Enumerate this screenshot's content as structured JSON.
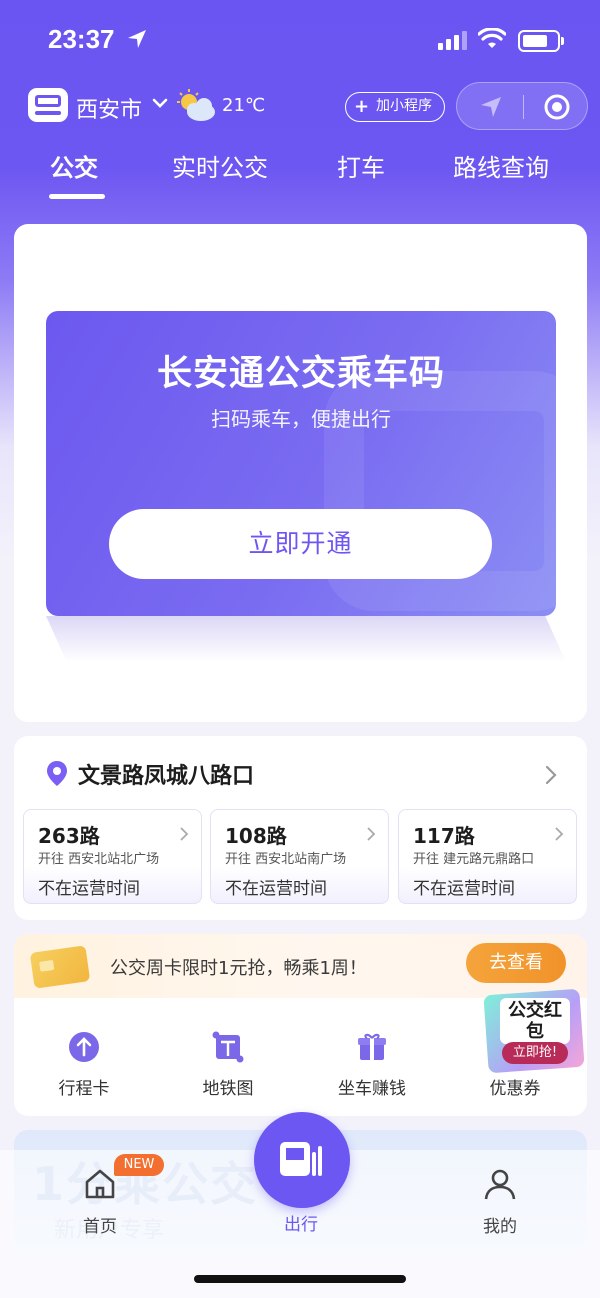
{
  "status_bar": {
    "time": "23:37"
  },
  "header": {
    "city": "西安市",
    "temperature": "21℃",
    "add_mini_program": "加小程序",
    "weather_icon": "partly-cloudy-icon"
  },
  "tabs": [
    {
      "label": "公交",
      "active": true
    },
    {
      "label": "实时公交",
      "active": false
    },
    {
      "label": "打车",
      "active": false
    },
    {
      "label": "路线查询",
      "active": false
    }
  ],
  "ride_code": {
    "title": "长安通公交乘车码",
    "subtitle": "扫码乘车，便捷出行",
    "button": "立即开通"
  },
  "nearby": {
    "stop_name": "文景路凤城八路口",
    "routes": [
      {
        "name": "263路",
        "direction": "开往 西安北站北广场",
        "status": "不在运营时间"
      },
      {
        "name": "108路",
        "direction": "开往 西安北站南广场",
        "status": "不在运营时间"
      },
      {
        "name": "117路",
        "direction": "开往 建元路元鼎路口",
        "status": "不在运营时间"
      }
    ]
  },
  "promo": {
    "text": "公交周卡限时1元抢，畅乘1周！",
    "button": "去查看"
  },
  "grid": [
    {
      "label": "行程卡",
      "icon": "arrow-up-circle-icon"
    },
    {
      "label": "地铁图",
      "icon": "metro-map-icon"
    },
    {
      "label": "坐车赚钱",
      "icon": "gift-box-icon"
    },
    {
      "label": "优惠券",
      "icon": "coupon-icon"
    }
  ],
  "hongbao": {
    "title": "公交红包",
    "button": "立即抢!"
  },
  "bottom_nav": {
    "home": "首页",
    "home_badge": "NEW",
    "ride": "出行",
    "mine": "我的"
  },
  "colors": {
    "brand": "#6d57f2",
    "promo_button": "#f1922a",
    "badge": "#f36f2f"
  }
}
